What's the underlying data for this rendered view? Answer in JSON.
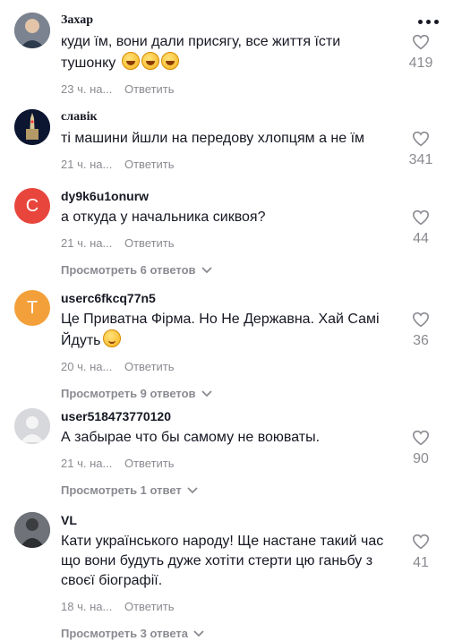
{
  "comments": [
    {
      "username": "Захар",
      "text_lines": [
        "куди їм, вони дали присягу, все життя їсти",
        "тушонку"
      ],
      "emojis": [
        "laughing-face",
        "laughing-face",
        "laughing-face"
      ],
      "time": "23 ч. на...",
      "reply": "Ответить",
      "likes": "419",
      "replies": "",
      "avatar": {
        "type": "photo",
        "color": "#5b6370"
      }
    },
    {
      "username": "славік",
      "text_lines": [
        "ті машини йшли на передову хлопцям а не їм"
      ],
      "emojis": [],
      "time": "21 ч. на...",
      "reply": "Ответить",
      "likes": "341",
      "replies": "",
      "avatar": {
        "type": "photo",
        "color": "#0d1630"
      }
    },
    {
      "username": "dy9k6u1onurw",
      "text_lines": [
        "а откуда у начальника сиквоя?"
      ],
      "emojis": [],
      "time": "21 ч. на...",
      "reply": "Ответить",
      "likes": "44",
      "replies": "Просмотреть 6 ответов",
      "avatar": {
        "type": "letter",
        "letter": "C",
        "color": "#e8453c"
      }
    },
    {
      "username": "userc6fkcq77n5",
      "text_lines": [
        "Це Приватна Фірма. Но Не Державна. Хай Самі",
        "Йдуть"
      ],
      "emojis": [
        "smiling-face"
      ],
      "time": "20 ч. на...",
      "reply": "Ответить",
      "likes": "36",
      "replies": "Просмотреть 9 ответов",
      "avatar": {
        "type": "letter",
        "letter": "T",
        "color": "#f3a03a"
      }
    },
    {
      "username": "user518473770120",
      "text_lines": [
        "А забырае что бы самому не воюваты."
      ],
      "emojis": [],
      "time": "21 ч. на...",
      "reply": "Ответить",
      "likes": "90",
      "replies": "Просмотреть 1 ответ",
      "avatar": {
        "type": "default",
        "color": "#d7d8db"
      }
    },
    {
      "username": "VL",
      "text_lines": [
        "Кати українського народу! Ще настане такий час",
        "що вони будуть дуже хотіти стерти цю ганьбу з",
        "своєї біографії."
      ],
      "emojis": [],
      "time": "18 ч. на...",
      "reply": "Ответить",
      "likes": "41",
      "replies": "Просмотреть 3 ответа",
      "avatar": {
        "type": "photo",
        "color": "#3c3f44"
      }
    }
  ]
}
